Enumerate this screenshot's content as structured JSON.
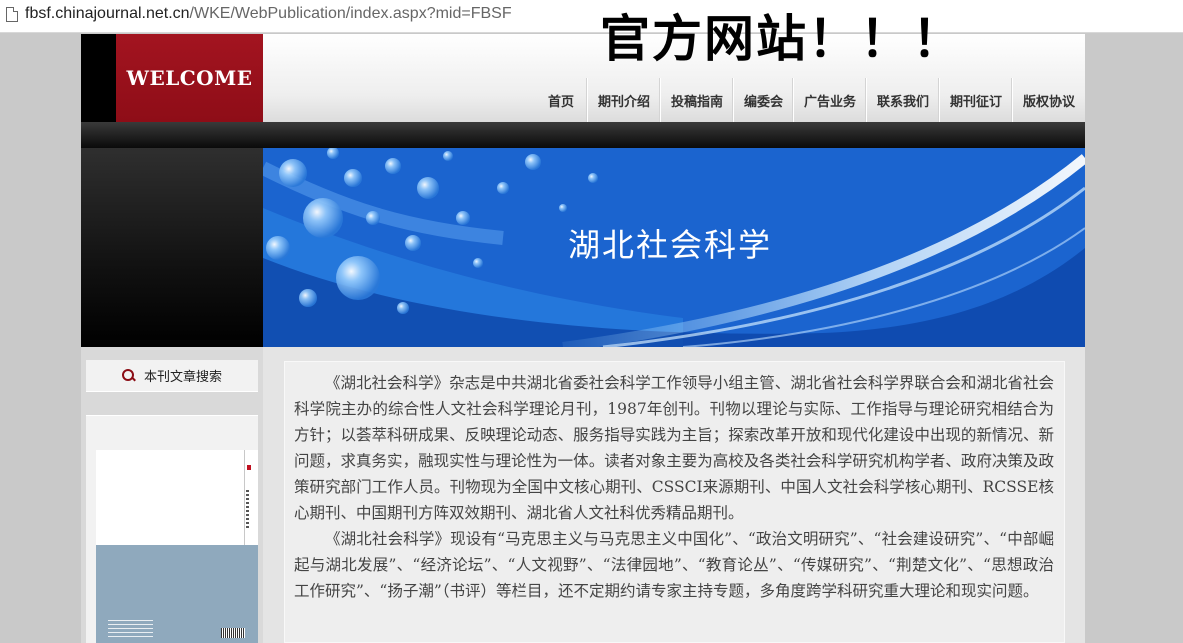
{
  "browser": {
    "url_host": "fbsf.chinajournal.net.cn",
    "url_rest": "/WKE/WebPublication/index.aspx?mid=FBSF"
  },
  "overlay_caption": "官方网站！！！",
  "header": {
    "logo_text": "WELCOME",
    "nav": [
      "首页",
      "期刊介绍",
      "投稿指南",
      "编委会",
      "广告业务",
      "联系我们",
      "期刊征订",
      "版权协议"
    ]
  },
  "hero": {
    "title": "湖北社会科学"
  },
  "sidebar": {
    "search_label": "本刊文章搜索"
  },
  "content": {
    "paragraphs": [
      "《湖北社会科学》杂志是中共湖北省委社会科学工作领导小组主管、湖北省社会科学界联合会和湖北省社会科学院主办的综合性人文社会科学理论月刊，1987年创刊。刊物以理论与实际、工作指导与理论研究相结合为方针；以荟萃科研成果、反映理论动态、服务指导实践为主旨；探索改革开放和现代化建设中出现的新情况、新问题，求真务实，融现实性与理论性为一体。读者对象主要为高校及各类社会科学研究机构学者、政府决策及政策研究部门工作人员。刊物现为全国中文核心期刊、CSSCI来源期刊、中国人文社会科学核心期刊、RCSSE核心期刊、中国期刊方阵双效期刊、湖北省人文社科优秀精品期刊。",
      "《湖北社会科学》现设有“马克思主义与马克思主义中国化”、“政治文明研究”、“社会建设研究”、“中部崛起与湖北发展”、“经济论坛”、“人文视野”、“法律园地”、“教育论丛”、“传媒研究”、“荆楚文化”、“思想政治工作研究”、“扬子潮”（书评）等栏目，还不定期约请专家主持专题，多角度跨学科研究重大理论和现实问题。"
    ]
  },
  "colors": {
    "logo_red": "#a31420",
    "hero_blue": "#1a5fc7",
    "search_icon": "#8b0d15"
  }
}
